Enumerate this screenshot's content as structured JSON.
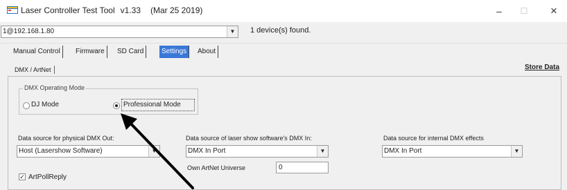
{
  "window": {
    "title": "Laser Controller Test Tool",
    "version": "v1.33",
    "date": "(Mar 25 2019)",
    "controls": {
      "minimize": "–",
      "maximize": "☐",
      "close": "×"
    }
  },
  "device": {
    "selected": "1@192.168.1.80",
    "found_text": "1 device(s) found."
  },
  "tabs": [
    "Manual Control",
    "Firmware",
    "SD Card",
    "Settings",
    "About"
  ],
  "active_tab": "Settings",
  "subtab": "DMX / ArtNet",
  "store_button": "Store Data",
  "operating_mode": {
    "legend": "DMX Operating Mode",
    "options": [
      "DJ Mode",
      "Professional Mode"
    ],
    "selected": "Professional Mode"
  },
  "physical_dmx": {
    "label": "Data source for physical DMX Out:",
    "value": "Host (Lasershow Software)"
  },
  "laser_dmx": {
    "label": "Data source of laser show software's DMX In:",
    "value": "DMX In Port"
  },
  "internal_dmx": {
    "label": "Data source for internal DMX effects",
    "value": "DMX In Port"
  },
  "artnet_universe": {
    "label": "Own ArtNet Universe",
    "value": "0"
  },
  "artpoll": {
    "label": "ArtPollReply",
    "checked": true
  },
  "icons": {
    "app": "app-icon",
    "dropdown": "chevron-down-icon",
    "annotation": "annotation-arrow-icon"
  },
  "colors": {
    "active_tab": "#3a78d8",
    "window_bg": "#f0f0f0"
  }
}
